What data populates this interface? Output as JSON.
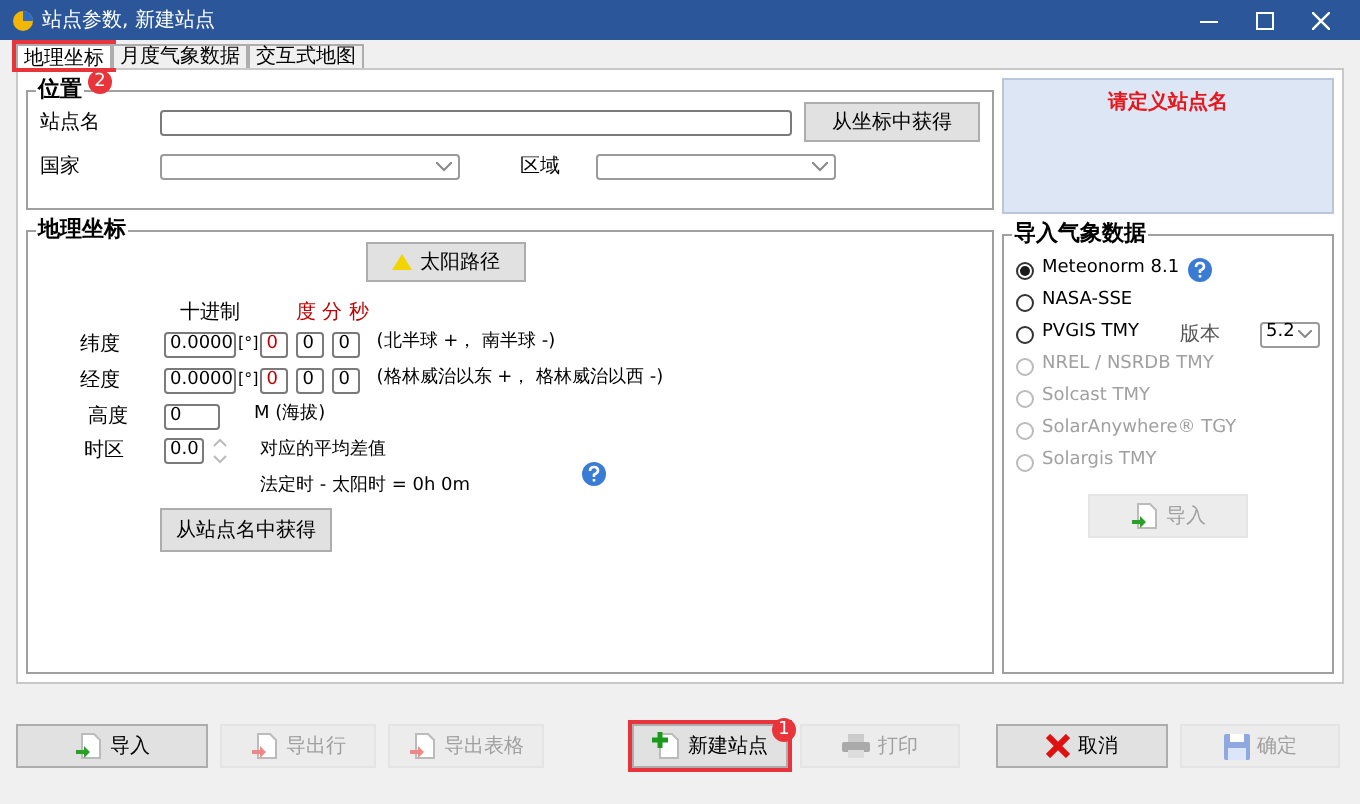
{
  "window": {
    "title": "站点参数, 新建站点"
  },
  "tabs": [
    {
      "label": "地理坐标",
      "selected": true,
      "annotation": "2"
    },
    {
      "label": "月度气象数据",
      "selected": false
    },
    {
      "label": "交互式地图",
      "selected": false
    }
  ],
  "location": {
    "title": "位置",
    "site_label": "站点名",
    "from_coords_button": "从坐标中获得",
    "country_label": "国家",
    "region_label": "区域"
  },
  "geo": {
    "title": "地理坐标",
    "sun_path_button": "太阳路径",
    "decimal_header": "十进制",
    "dms_header": "度 分 秒",
    "coords": [
      {
        "label": "纬度",
        "decimal": "0.0000",
        "unit": "[°]",
        "dms": [
          "0",
          "0",
          "0"
        ],
        "note": "(北半球 +， 南半球 -)"
      },
      {
        "label": "经度",
        "decimal": "0.0000",
        "unit": "[°]",
        "dms": [
          "0",
          "0",
          "0"
        ],
        "note": "(格林威治以东 +， 格林威治以西 -)"
      }
    ],
    "altitude": {
      "label": "高度",
      "value": "0",
      "unit": "M (海拔)"
    },
    "timezone": {
      "label": "时区",
      "value": "0.0",
      "note": "对应的平均差值",
      "offset": "法定时 - 太阳时 =  0h 0m"
    },
    "from_name_button": "从站点名中获得"
  },
  "banner": "请定义站点名",
  "import": {
    "title": "导入气象数据",
    "version_label": "版本",
    "version": "5.2",
    "button": "导入",
    "button_disabled": true,
    "sources": [
      {
        "label": "Meteonorm 8.1",
        "selected": true,
        "disabled": false
      },
      {
        "label": "NASA-SSE",
        "selected": false,
        "disabled": false
      },
      {
        "label": "PVGIS TMY",
        "selected": false,
        "disabled": false,
        "has_version": true
      },
      {
        "label": "NREL / NSRDB TMY",
        "selected": false,
        "disabled": true
      },
      {
        "label": "Solcast TMY",
        "selected": false,
        "disabled": true
      },
      {
        "label": "SolarAnywhere® TGY",
        "selected": false,
        "disabled": true
      },
      {
        "label": "Solargis TMY",
        "selected": false,
        "disabled": true
      }
    ]
  },
  "footer": [
    {
      "label": "导入",
      "kind": "import",
      "disabled": false
    },
    {
      "label": "导出行",
      "kind": "export",
      "disabled": true
    },
    {
      "label": "导出表格",
      "kind": "export",
      "disabled": true
    },
    {
      "label": "新建站点",
      "kind": "new",
      "disabled": false,
      "annotation": "1"
    },
    {
      "label": "打印",
      "kind": "print",
      "disabled": true
    },
    {
      "label": "取消",
      "kind": "cancel",
      "disabled": false
    },
    {
      "label": "确定",
      "kind": "save",
      "disabled": true
    }
  ]
}
